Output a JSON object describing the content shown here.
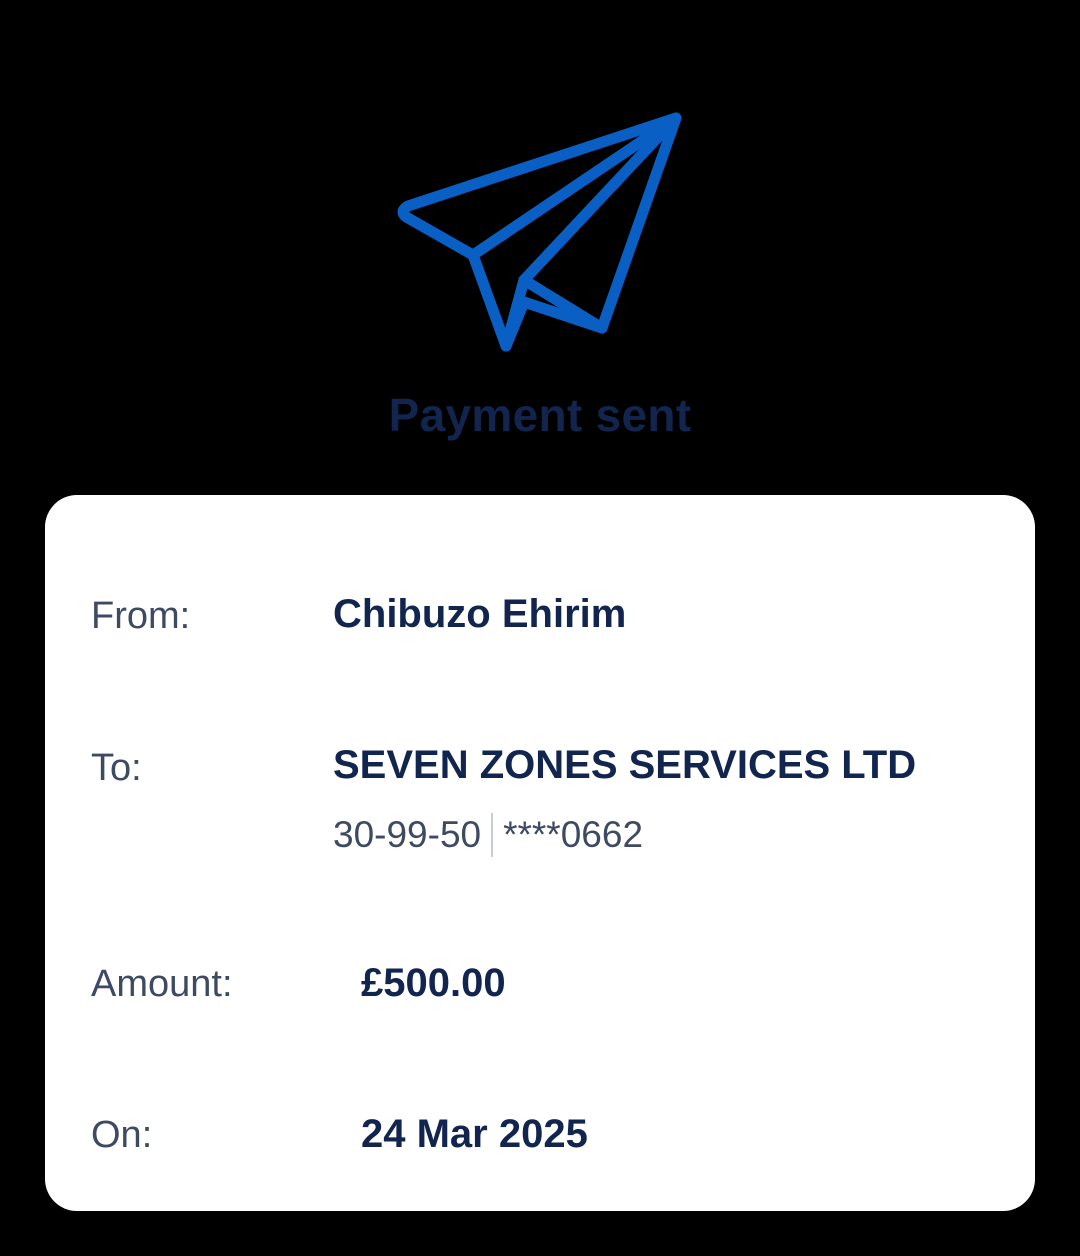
{
  "header": {
    "icon": "paper-plane-icon",
    "title": "Payment sent",
    "colors": {
      "icon": "#0a5fc4",
      "title": "#12254f",
      "background": "#000000",
      "card": "#ffffff"
    }
  },
  "details": {
    "from": {
      "label": "From:",
      "value": "Chibuzo Ehirim"
    },
    "to": {
      "label": "To:",
      "value": "SEVEN ZONES SERVICES LTD",
      "sort_code": "30-99-50",
      "account_masked": "****0662"
    },
    "amount": {
      "label": "Amount:",
      "value": "£500.00"
    },
    "on": {
      "label": "On:",
      "value": "24 Mar 2025"
    }
  }
}
